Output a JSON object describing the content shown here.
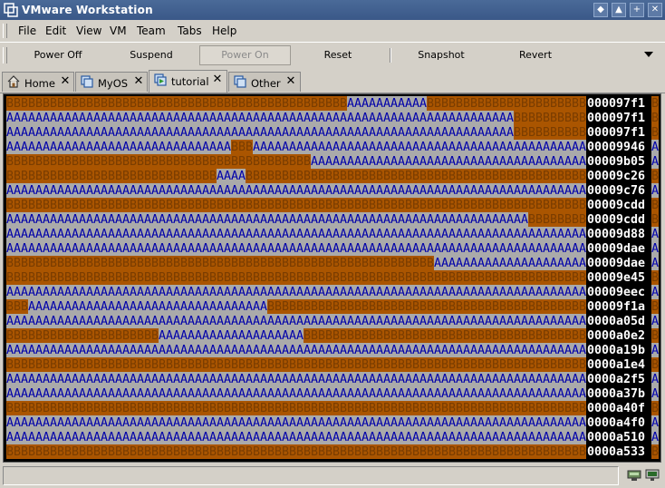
{
  "window": {
    "title": "VMware Workstation",
    "buttons": [
      "shade-icon",
      "maximize-icon",
      "add-icon",
      "close-icon"
    ]
  },
  "menubar": {
    "items": [
      {
        "label": "File"
      },
      {
        "label": "Edit"
      },
      {
        "label": "View"
      },
      {
        "label": "VM"
      },
      {
        "label": "Team"
      },
      {
        "label": "Tabs"
      },
      {
        "label": "Help"
      }
    ]
  },
  "toolbar": {
    "power_off": "Power Off",
    "suspend": "Suspend",
    "power_on": "Power On",
    "reset": "Reset",
    "snapshot": "Snapshot",
    "revert": "Revert"
  },
  "tabs": [
    {
      "label": "Home",
      "icon": "home-icon",
      "active": false
    },
    {
      "label": "MyOS",
      "icon": "vm-icon",
      "active": false
    },
    {
      "label": "tutorial",
      "icon": "vm-running-icon",
      "active": true
    },
    {
      "label": "Other",
      "icon": "vm-icon",
      "active": false
    }
  ],
  "screen": {
    "colors": {
      "b_bg": "#aa5500",
      "b_fg": "#7a3d00",
      "a_bg": "#aaaaaa",
      "a_fg": "#0000aa",
      "addr_bg": "#000000",
      "addr_fg": "#ffffff"
    },
    "rows": [
      {
        "segments": [
          [
            "B",
            47
          ],
          [
            "A",
            11
          ],
          [
            "B",
            22
          ]
        ],
        "address": "000097f1",
        "trail": "B"
      },
      {
        "segments": [
          [
            "A",
            70
          ],
          [
            "B",
            10
          ]
        ],
        "address": "000097f1",
        "trail": "B"
      },
      {
        "segments": [
          [
            "A",
            70
          ],
          [
            "B",
            10
          ]
        ],
        "address": "000097f1",
        "trail": "B"
      },
      {
        "segments": [
          [
            "A",
            31
          ],
          [
            "B",
            3
          ],
          [
            "A",
            46
          ]
        ],
        "address": "00009946",
        "trail": "A"
      },
      {
        "segments": [
          [
            "B",
            42
          ],
          [
            "A",
            38
          ]
        ],
        "address": "00009b05",
        "trail": "A"
      },
      {
        "segments": [
          [
            "B",
            29
          ],
          [
            "A",
            4
          ],
          [
            "B",
            47
          ]
        ],
        "address": "00009c26",
        "trail": "B"
      },
      {
        "segments": [
          [
            "A",
            80
          ]
        ],
        "address": "00009c76",
        "trail": "A"
      },
      {
        "segments": [
          [
            "B",
            80
          ]
        ],
        "address": "00009cdd",
        "trail": "B"
      },
      {
        "segments": [
          [
            "A",
            72
          ],
          [
            "B",
            8
          ]
        ],
        "address": "00009cdd",
        "trail": "B"
      },
      {
        "segments": [
          [
            "A",
            80
          ]
        ],
        "address": "00009d88",
        "trail": "A"
      },
      {
        "segments": [
          [
            "A",
            80
          ]
        ],
        "address": "00009dae",
        "trail": "A"
      },
      {
        "segments": [
          [
            "B",
            59
          ],
          [
            "A",
            21
          ]
        ],
        "address": "00009dae",
        "trail": "A"
      },
      {
        "segments": [
          [
            "B",
            80
          ]
        ],
        "address": "00009e45",
        "trail": "B"
      },
      {
        "segments": [
          [
            "A",
            80
          ]
        ],
        "address": "00009eec",
        "trail": "A"
      },
      {
        "segments": [
          [
            "B",
            3
          ],
          [
            "A",
            33
          ],
          [
            "B",
            44
          ]
        ],
        "address": "00009f1a",
        "trail": "B"
      },
      {
        "segments": [
          [
            "A",
            80
          ]
        ],
        "address": "0000a05d",
        "trail": "A"
      },
      {
        "segments": [
          [
            "B",
            21
          ],
          [
            "A",
            20
          ],
          [
            "B",
            39
          ]
        ],
        "address": "0000a0e2",
        "trail": "B"
      },
      {
        "segments": [
          [
            "A",
            80
          ]
        ],
        "address": "0000a19b",
        "trail": "A"
      },
      {
        "segments": [
          [
            "B",
            80
          ]
        ],
        "address": "0000a1e4",
        "trail": "B"
      },
      {
        "segments": [
          [
            "A",
            80
          ]
        ],
        "address": "0000a2f5",
        "trail": "A"
      },
      {
        "segments": [
          [
            "A",
            80
          ]
        ],
        "address": "0000a37b",
        "trail": "A"
      },
      {
        "segments": [
          [
            "B",
            80
          ]
        ],
        "address": "0000a40f",
        "trail": "B"
      },
      {
        "segments": [
          [
            "A",
            80
          ]
        ],
        "address": "0000a4f0",
        "trail": "A"
      },
      {
        "segments": [
          [
            "A",
            80
          ]
        ],
        "address": "0000a510",
        "trail": "A"
      },
      {
        "segments": [
          [
            "B",
            80
          ]
        ],
        "address": "0000a533",
        "trail": "B"
      }
    ]
  },
  "statusbar": {
    "icons": [
      "network-icon",
      "display-icon"
    ]
  }
}
